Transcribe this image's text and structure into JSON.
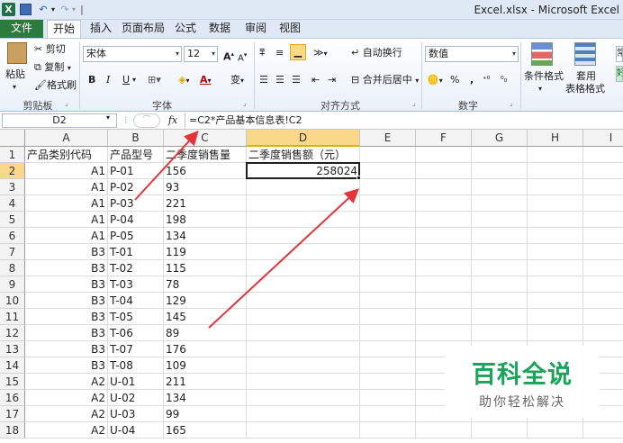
{
  "window": {
    "title": "Excel.xlsx - Microsoft Excel",
    "app_icon": "X"
  },
  "tabs": [
    "文件",
    "开始",
    "插入",
    "页面布局",
    "公式",
    "数据",
    "审阅",
    "视图"
  ],
  "ribbon": {
    "clipboard": {
      "paste": "粘贴",
      "cut": "剪切",
      "copy": "复制",
      "format_painter": "格式刷",
      "group": "剪贴板"
    },
    "font": {
      "name": "宋体",
      "size": "12",
      "bold": "B",
      "italic": "I",
      "underline": "U",
      "grow": "A",
      "shrink": "A",
      "group": "字体",
      "wen": "变"
    },
    "alignment": {
      "wrap_text": "自动换行",
      "merge_center": "合并后居中",
      "group": "对齐方式"
    },
    "number": {
      "format": "数值",
      "percent": "%",
      "comma": ",",
      "group": "数字"
    },
    "styles": {
      "conditional": "条件格式",
      "table_format_1": "套用",
      "table_format_2": "表格格式",
      "cell_style_partial": "常",
      "cell_style_partial2": "好"
    }
  },
  "formula_bar": {
    "name_box": "D2",
    "fx": "fx",
    "formula": "=C2*产品基本信息表!C2"
  },
  "columns": [
    "A",
    "B",
    "C",
    "D",
    "E",
    "F",
    "G",
    "H",
    "I"
  ],
  "rows": [
    "1",
    "2",
    "3",
    "4",
    "5",
    "6",
    "7",
    "8",
    "9",
    "10",
    "11",
    "12",
    "13",
    "14",
    "15",
    "16",
    "17",
    "18"
  ],
  "cells": {
    "header": [
      "产品类别代码",
      "产品型号",
      "二季度销售量",
      "二季度销售额（元）"
    ],
    "data": [
      [
        "A1",
        "P-01",
        "156",
        "258024"
      ],
      [
        "A1",
        "P-02",
        "93",
        ""
      ],
      [
        "A1",
        "P-03",
        "221",
        ""
      ],
      [
        "A1",
        "P-04",
        "198",
        ""
      ],
      [
        "A1",
        "P-05",
        "134",
        ""
      ],
      [
        "B3",
        "T-01",
        "119",
        ""
      ],
      [
        "B3",
        "T-02",
        "115",
        ""
      ],
      [
        "B3",
        "T-03",
        "78",
        ""
      ],
      [
        "B3",
        "T-04",
        "129",
        ""
      ],
      [
        "B3",
        "T-05",
        "145",
        ""
      ],
      [
        "B3",
        "T-06",
        "89",
        ""
      ],
      [
        "B3",
        "T-07",
        "176",
        ""
      ],
      [
        "B3",
        "T-08",
        "109",
        ""
      ],
      [
        "A2",
        "U-01",
        "211",
        ""
      ],
      [
        "A2",
        "U-02",
        "134",
        ""
      ],
      [
        "A2",
        "U-03",
        "99",
        ""
      ],
      [
        "A2",
        "U-04",
        "165",
        ""
      ]
    ]
  },
  "watermark": {
    "title": "百科全说",
    "subtitle": "助你轻松解决"
  },
  "colors": {
    "accent": "#e2343a",
    "selected_header": "#f9d88a",
    "file_tab": "#2b7a3e",
    "watermark": "#1aa35a"
  }
}
